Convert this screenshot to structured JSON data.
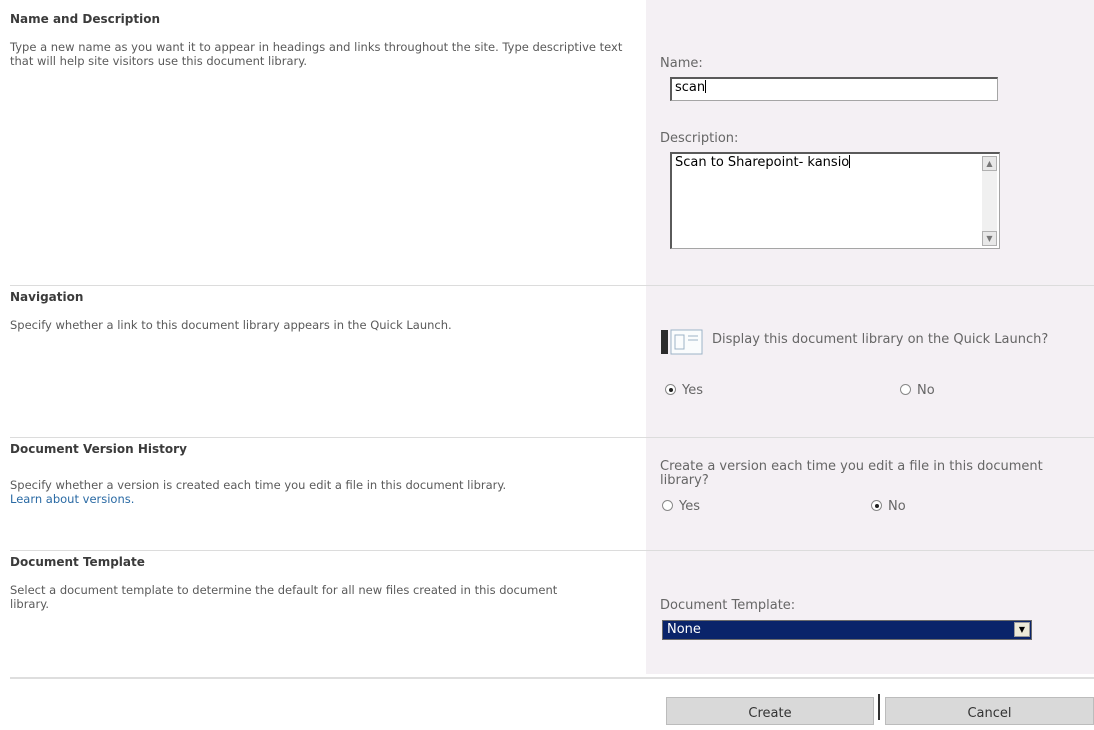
{
  "name_section": {
    "heading": "Name and Description",
    "description": "Type a new name as you want it to appear in headings and links throughout the site. Type descriptive text that will help site visitors use this document library.",
    "name_label": "Name:",
    "name_value": "scan",
    "description_label": "Description:",
    "description_value": "Scan to Sharepoint- kansio"
  },
  "navigation_section": {
    "heading": "Navigation",
    "description": "Specify whether a link to this document library appears in the Quick Launch.",
    "question": "Display this document library on the Quick Launch?",
    "options": [
      {
        "label": "Yes",
        "selected": true
      },
      {
        "label": "No",
        "selected": false
      }
    ]
  },
  "version_section": {
    "heading": "Document Version History",
    "description": "Specify whether a version is created each time you edit a file in this document library.",
    "link_text": "Learn about versions.",
    "question": "Create a version each time you edit a file in this document library?",
    "options": [
      {
        "label": "Yes",
        "selected": false
      },
      {
        "label": "No",
        "selected": true
      }
    ]
  },
  "template_section": {
    "heading": "Document Template",
    "description": "Select a document template to determine the default for all new files created in this document library.",
    "template_label": "Document Template:",
    "template_value": "None"
  },
  "buttons": {
    "create": "Create",
    "cancel": "Cancel"
  }
}
